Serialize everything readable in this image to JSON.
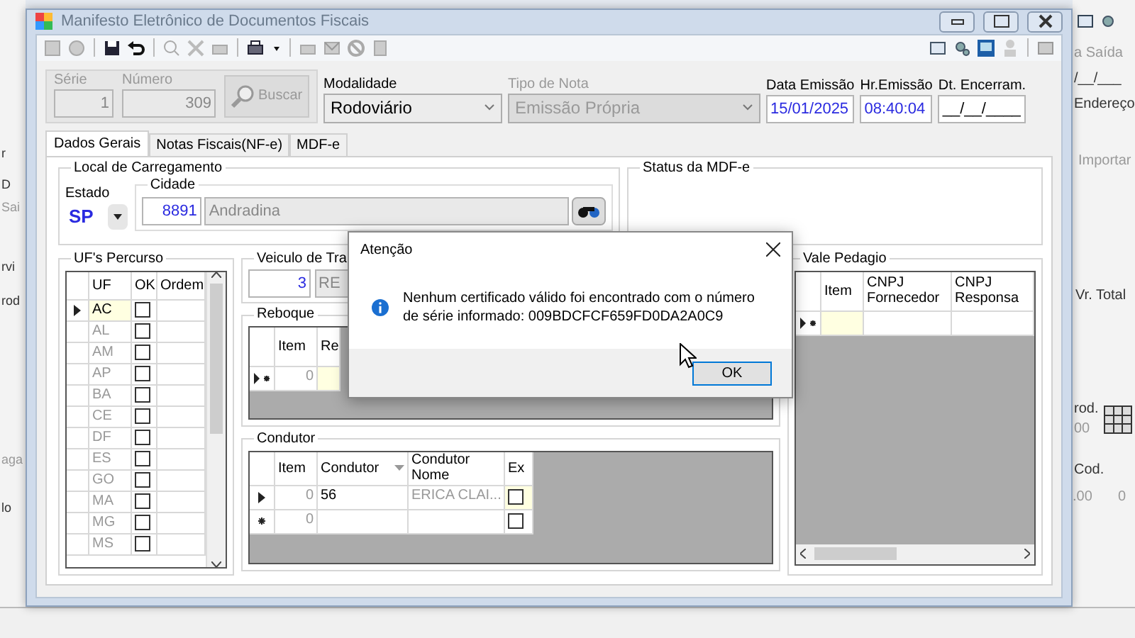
{
  "background_window": {
    "left_texts": [
      "r",
      "D",
      "Sai",
      "rvi",
      "rod",
      "aga",
      "lo"
    ],
    "right_texts": [
      "a Saída",
      "/__/___",
      "Endereço",
      "Importar",
      "Vr. Total",
      "rod.",
      "00",
      "Cod.",
      ".00",
      "0"
    ]
  },
  "window": {
    "title": "Manifesto Eletrônico de Documentos Fiscais"
  },
  "header": {
    "serie": {
      "label": "Série",
      "value": "1"
    },
    "numero": {
      "label": "Número",
      "value": "309"
    },
    "buscar": "Buscar",
    "modalidade": {
      "label": "Modalidade",
      "value": "Rodoviário"
    },
    "tipo_nota": {
      "label": "Tipo de Nota",
      "value": "Emissão Própria"
    },
    "data_emissao": {
      "label": "Data Emissão",
      "value": "15/01/2025"
    },
    "hr_emissao": {
      "label": "Hr.Emissão",
      "value": "08:40:04"
    },
    "dt_encerram": {
      "label": "Dt. Encerram.",
      "value": "__/__/____"
    }
  },
  "tabs": [
    {
      "label": "Dados Gerais",
      "selected": true
    },
    {
      "label": "Notas Fiscais(NF-e)",
      "selected": false
    },
    {
      "label": "MDF-e",
      "selected": false
    }
  ],
  "local_carregamento": {
    "title": "Local de Carregamento",
    "estado_label": "Estado",
    "estado": "SP",
    "cidade_label": "Cidade",
    "cidade_code": "8891",
    "cidade_name": "Andradina"
  },
  "status_mdfe": {
    "title": "Status da MDF-e"
  },
  "ufs_percurso": {
    "title": "UF's Percurso",
    "columns": [
      "UF",
      "OK",
      "Ordem"
    ],
    "rows": [
      {
        "uf": "AC",
        "ok": false,
        "current": true
      },
      {
        "uf": "AL",
        "ok": false,
        "current": false
      },
      {
        "uf": "AM",
        "ok": false,
        "current": false
      },
      {
        "uf": "AP",
        "ok": false,
        "current": false
      },
      {
        "uf": "BA",
        "ok": false,
        "current": false
      },
      {
        "uf": "CE",
        "ok": false,
        "current": false
      },
      {
        "uf": "DF",
        "ok": false,
        "current": false
      },
      {
        "uf": "ES",
        "ok": false,
        "current": false
      },
      {
        "uf": "GO",
        "ok": false,
        "current": false
      },
      {
        "uf": "MA",
        "ok": false,
        "current": false
      },
      {
        "uf": "MG",
        "ok": false,
        "current": false
      },
      {
        "uf": "MS",
        "ok": false,
        "current": false
      }
    ]
  },
  "veiculo_tracao": {
    "title": "Veiculo de Tra",
    "code": "3",
    "name": "RE"
  },
  "reboque": {
    "title": "Reboque",
    "columns": [
      "Item",
      "Re"
    ],
    "rows": [
      {
        "kind": "new",
        "item": "0"
      }
    ]
  },
  "condutor": {
    "title": "Condutor",
    "columns": [
      "Item",
      "Condutor",
      "Condutor Nome",
      "Ex"
    ],
    "rows": [
      {
        "kind": "current",
        "item": "0",
        "condutor": "56",
        "nome": "ERICA CLAI...",
        "ex": false
      },
      {
        "kind": "new",
        "item": "0",
        "ex": false
      }
    ]
  },
  "vale_pedagio": {
    "title": "Vale Pedagio",
    "columns": [
      "Item",
      "CNPJ Fornecedor",
      "CNPJ Responsa"
    ],
    "rows": [
      {
        "kind": "new"
      }
    ]
  },
  "dialog": {
    "title": "Atenção",
    "message": "Nenhum certificado válido foi encontrado com o número de série informado: 009BDCFCF659FD0DA2A0C9",
    "ok": "OK"
  }
}
